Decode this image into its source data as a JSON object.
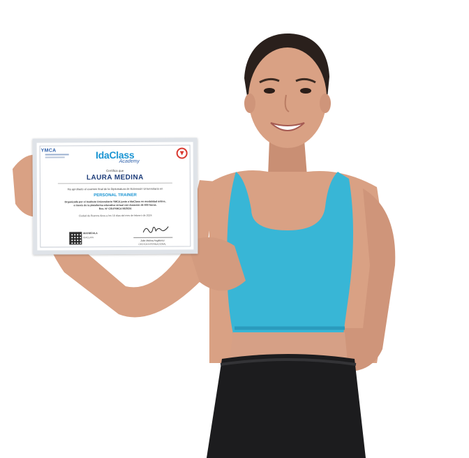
{
  "certificate": {
    "ymca_mark": "YMCA",
    "logo_text": "IdaClass",
    "logo_subtext": "Academy",
    "certify_label": "Certifica que",
    "recipient_name": "LAURA MEDINA",
    "passed_text": "Ha aprobado el examen final de la Diplomatura de Extensión Universitaria en",
    "program": "PERSONAL TRAINER",
    "organized_line1": "Organizada por el Instituto Universitario YMCA junto a IdaClass en modalidad online,",
    "organized_line2": "a través de la plataforma educativa virtual con duración de 650 horas.",
    "resolution": "Res. N° CSU/YMCA 56/2024",
    "place_date": "Ciudad de Buenos Aires a los 10 días del mes de febrero de 2024",
    "matricula_label": "MATRÍCULA",
    "matricula_value": "IDACLASS",
    "signatory_name": "Julio Molina Anglionisi",
    "signatory_role": "CEO IDA INTERNACIONAL"
  },
  "colors": {
    "top": "#38b6d6",
    "skin": "#d9a184",
    "pants": "#1c1c1e",
    "brand_blue": "#1b95d3"
  }
}
